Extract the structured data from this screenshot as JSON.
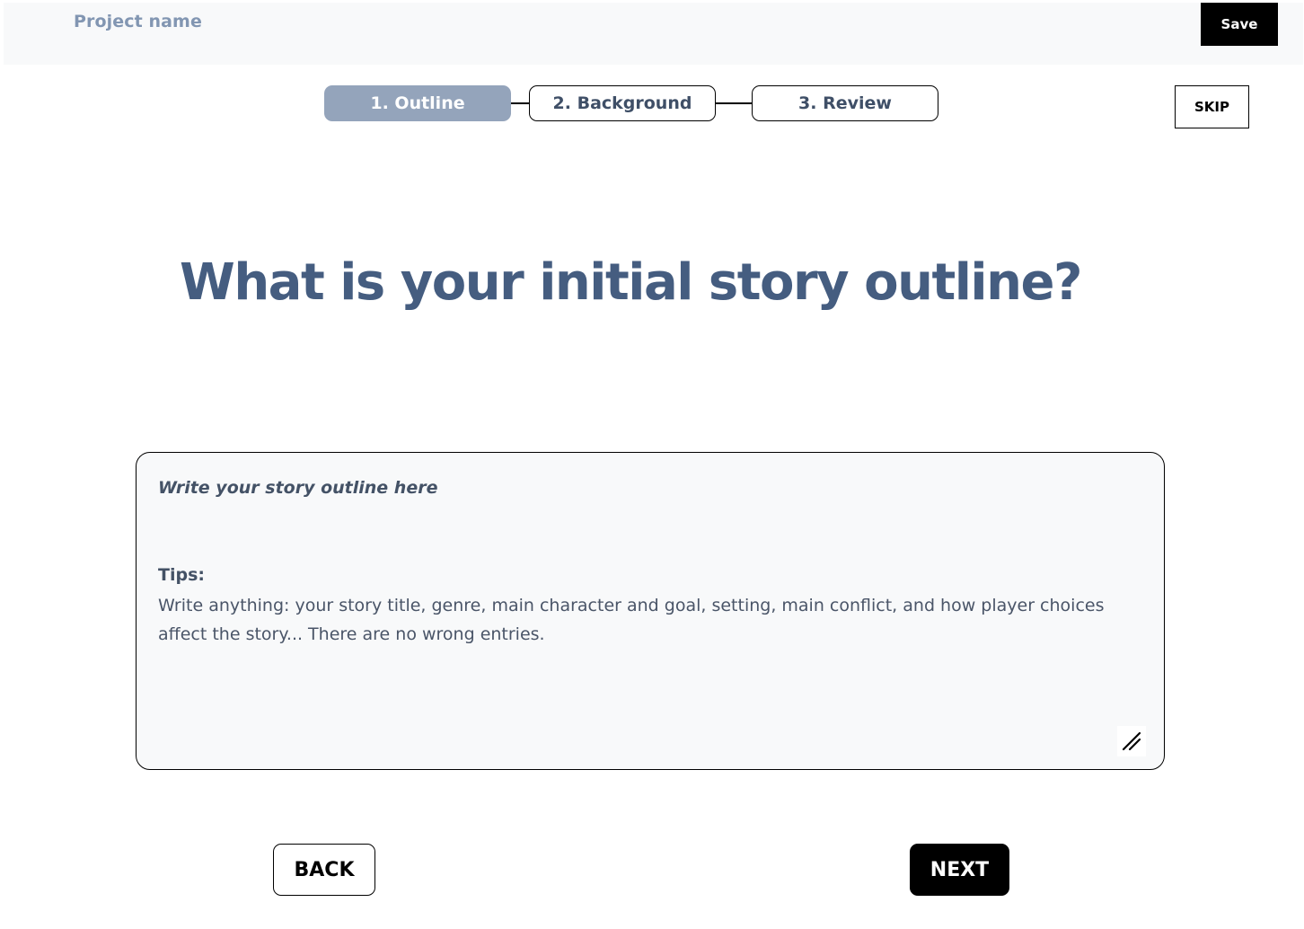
{
  "header": {
    "project_name": "Project name",
    "save_label": "Save"
  },
  "stepper": {
    "steps": [
      {
        "label": "1. Outline",
        "state": "active"
      },
      {
        "label": "2. Background",
        "state": "inactive"
      },
      {
        "label": "3. Review",
        "state": "inactive"
      }
    ],
    "skip_label": "SKIP"
  },
  "main": {
    "question": "What is your initial story outline?",
    "outline_input": {
      "placeholder": "Write your story outline here",
      "tips_label": "Tips:",
      "tips_text": "Write anything: your story title, genre, main character and goal, setting, main conflict, and how player choices affect the story... There are no wrong entries.",
      "value": ""
    }
  },
  "footer": {
    "back_label": "BACK",
    "next_label": "NEXT"
  },
  "colors": {
    "accent": "#455d80",
    "active_step": "#94a4bb",
    "project_name": "#8296b2",
    "panel_background": "#f8f9fa"
  },
  "icons": {
    "resize": "resize-handle-icon"
  }
}
